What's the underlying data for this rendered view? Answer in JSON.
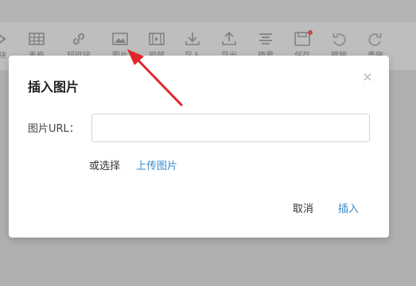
{
  "toolbar": {
    "items": [
      {
        "icon": "quote-icon",
        "label": "块"
      },
      {
        "icon": "table-icon",
        "label": "表格"
      },
      {
        "icon": "link-icon",
        "label": "超链接"
      },
      {
        "icon": "image-icon",
        "label": "图片"
      },
      {
        "icon": "video-icon",
        "label": "视频"
      },
      {
        "icon": "import-icon",
        "label": "导入"
      },
      {
        "icon": "export-icon",
        "label": "导出"
      },
      {
        "icon": "outline-icon",
        "label": "摘要"
      },
      {
        "icon": "save-icon",
        "label": "保存"
      },
      {
        "icon": "undo-icon",
        "label": "撤销"
      },
      {
        "icon": "redo-icon",
        "label": "重做"
      }
    ]
  },
  "dialog": {
    "title": "插入图片",
    "close": "×",
    "url_label": "图片URL：",
    "url_value": "",
    "or_select": "或选择",
    "upload_link": "上传图片",
    "cancel": "取消",
    "insert": "插入"
  },
  "colors": {
    "accent": "#3a8bcf",
    "arrow": "#e0262b",
    "badge": "#e05a5a"
  }
}
